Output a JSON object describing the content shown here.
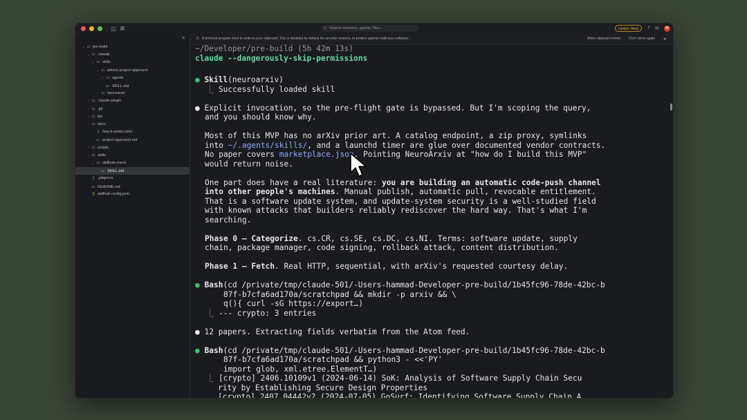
{
  "titlebar": {
    "search_placeholder": "Search sessions, agents, files...",
    "update_label": "Update Warp",
    "avatar_initial": "M"
  },
  "sidebar": {
    "items": [
      {
        "label": "pre-build",
        "type": "folder",
        "open": true,
        "depth": 0
      },
      {
        "label": ".claude",
        "type": "folder",
        "open": true,
        "depth": 1
      },
      {
        "label": "skills",
        "type": "folder",
        "open": true,
        "depth": 2
      },
      {
        "label": "advise-project-approach",
        "type": "folder",
        "open": true,
        "depth": 3
      },
      {
        "label": "agents",
        "type": "folder",
        "open": false,
        "depth": 4
      },
      {
        "label": "SKILL.md",
        "type": "md",
        "depth": 4
      },
      {
        "label": "neuroarxiv",
        "type": "folder",
        "open": false,
        "depth": 3
      },
      {
        "label": ".claude-plugin",
        "type": "folder",
        "open": false,
        "depth": 1
      },
      {
        "label": ".git",
        "type": "folder",
        "open": false,
        "depth": 1
      },
      {
        "label": "bin",
        "type": "folder",
        "open": false,
        "depth": 1
      },
      {
        "label": "docs",
        "type": "folder",
        "open": true,
        "depth": 1
      },
      {
        "label": "how-it-works.html",
        "type": "file",
        "depth": 2
      },
      {
        "label": "project-approach.md",
        "type": "md",
        "depth": 2
      },
      {
        "label": "scripts",
        "type": "folder",
        "open": false,
        "depth": 1
      },
      {
        "label": "skills",
        "type": "folder",
        "open": true,
        "depth": 1
      },
      {
        "label": "skillhub-check",
        "type": "folder",
        "open": true,
        "depth": 2
      },
      {
        "label": "SKILL.md",
        "type": "md",
        "depth": 3,
        "selected": true
      },
      {
        "label": ".gitignore",
        "type": "file",
        "depth": 1
      },
      {
        "label": "README.md",
        "type": "md",
        "depth": 1
      },
      {
        "label": "skillhub.config.json",
        "type": "json",
        "depth": 1
      }
    ]
  },
  "banner": {
    "message": "A terminal program tried to write to your clipboard. This is disabled by default for security reasons, to protect against malicious software.",
    "allow_label": "Allow clipboard writes",
    "dismiss_label": "Don't show again"
  },
  "terminal": {
    "path": "~/Developer/pre-build (5h 42m 13s)",
    "command": "claude --dangerously-skip-permissions",
    "skill_name": "Skill",
    "skill_arg": "(neuroarxiv)",
    "skill_result": "Successfully loaded skill",
    "p1_l1": "Explicit invocation, so the pre-flight gate is bypassed. But I'm scoping the query,",
    "p1_l2": "and you should know why.",
    "p2_l1": "Most of this MVP has no arXiv prior art. A catalog endpoint, a zip proxy, symlinks",
    "p2_l2_a": "into ",
    "p2_l2_link": "~/.agents/skills/",
    "p2_l2_b": ", and a launchd timer are glue over documented vendor contracts.",
    "p2_l3_a": "No paper covers ",
    "p2_l3_link": "marketplace.json",
    "p2_l3_b": ". Pointing NeuroArxiv at \"how do I build this MVP\"",
    "p2_l4": "would return noise.",
    "p3_l1_a": "One part does have a real literature: ",
    "p3_l1_b": "you are building an automatic code-push channel",
    "p3_l2_a": "into other people's machines",
    "p3_l2_b": ". Manual publish, automatic pull, revocable entitlement.",
    "p3_l3": "That is a software update system, and update-system security is a well-studied field",
    "p3_l4": "with known attacks that builders reliably rediscover the hard way. That's what I'm",
    "p3_l5": "searching.",
    "p4_a": "Phase 0 — Categorize",
    "p4_b": ". cs.CR, cs.SE, cs.DC, cs.NI. Terms: software update, supply",
    "p4_l2": "chain, package manager, code signing, rollback attack, content distribution.",
    "p5_a": "Phase 1 — Fetch",
    "p5_b": ". Real HTTP, sequential, with arXiv's requested courtesy delay.",
    "bash1_name": "Bash",
    "bash1_l1": "(cd /private/tmp/claude-501/-Users-hammad-Developer-pre-build/1b45fc96-78de-42bc-b",
    "bash1_l2": "87f-b7cfa6ad170a/scratchpad && mkdir -p arxiv && \\",
    "bash1_l3": "q(){ curl -sG https://export…)",
    "bash1_result": "--- crypto: 3 entries",
    "p6": "12 papers. Extracting fields verbatim from the Atom feed.",
    "bash2_name": "Bash",
    "bash2_l1": "(cd /private/tmp/claude-501/-Users-hammad-Developer-pre-build/1b45fc96-78de-42bc-b",
    "bash2_l2": "87f-b7cfa6ad170a/scratchpad && python3 - <<'PY'",
    "bash2_l3": "import glob, xml.etree.ElementT…)",
    "bash2_r1": "[crypto] 2406.10109v1 (2024-06-14) SoK: Analysis of Software Supply Chain Secu",
    "bash2_r2": "rity by Establishing Secure Design Properties",
    "bash2_r3": "[crypto] 2407.04442v2 (2024-07-05) GoSurf: Identifying Software Supply Chain A"
  }
}
